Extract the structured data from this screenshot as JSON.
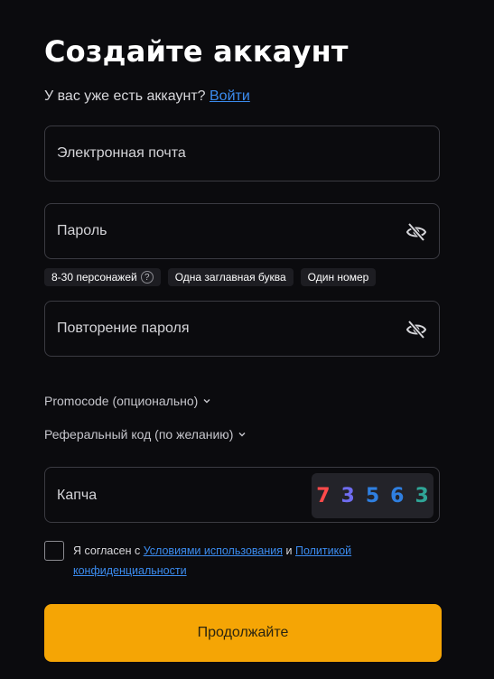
{
  "header": {
    "title": "Создайте аккаунт",
    "have_account_text": "У вас уже есть аккаунт?",
    "login_link": "Войти"
  },
  "form": {
    "email": {
      "placeholder": "Электронная почта",
      "value": ""
    },
    "password": {
      "placeholder": "Пароль",
      "value": "",
      "toggle_icon": "eye-off-icon"
    },
    "password_hints": [
      {
        "label": "8-30 персонажей",
        "has_help_icon": true
      },
      {
        "label": "Одна заглавная буква"
      },
      {
        "label": "Один номер"
      }
    ],
    "password_repeat": {
      "placeholder": "Повторение пароля",
      "value": "",
      "toggle_icon": "eye-off-icon"
    },
    "promocode_toggle": "Promocode (опционально)",
    "referral_toggle": "Реферальный код (по желанию)",
    "captcha": {
      "placeholder": "Капча",
      "digits": [
        {
          "char": "7",
          "color": "#ff4a4a"
        },
        {
          "char": "3",
          "color": "#6f6cf0"
        },
        {
          "char": "5",
          "color": "#2f7fe0"
        },
        {
          "char": "6",
          "color": "#2f7fe0"
        },
        {
          "char": "3",
          "color": "#2fa597"
        }
      ]
    },
    "agreement": {
      "prefix": "Я согласен с",
      "terms_link": "Условиями использования",
      "conjunction": "и",
      "privacy_link": "Политикой конфиденциальности"
    },
    "submit_label": "Продолжайте"
  },
  "colors": {
    "background": "#0b0b0e",
    "accent": "#f5a505",
    "link": "#3b8cf0",
    "border": "#3b3b42"
  }
}
